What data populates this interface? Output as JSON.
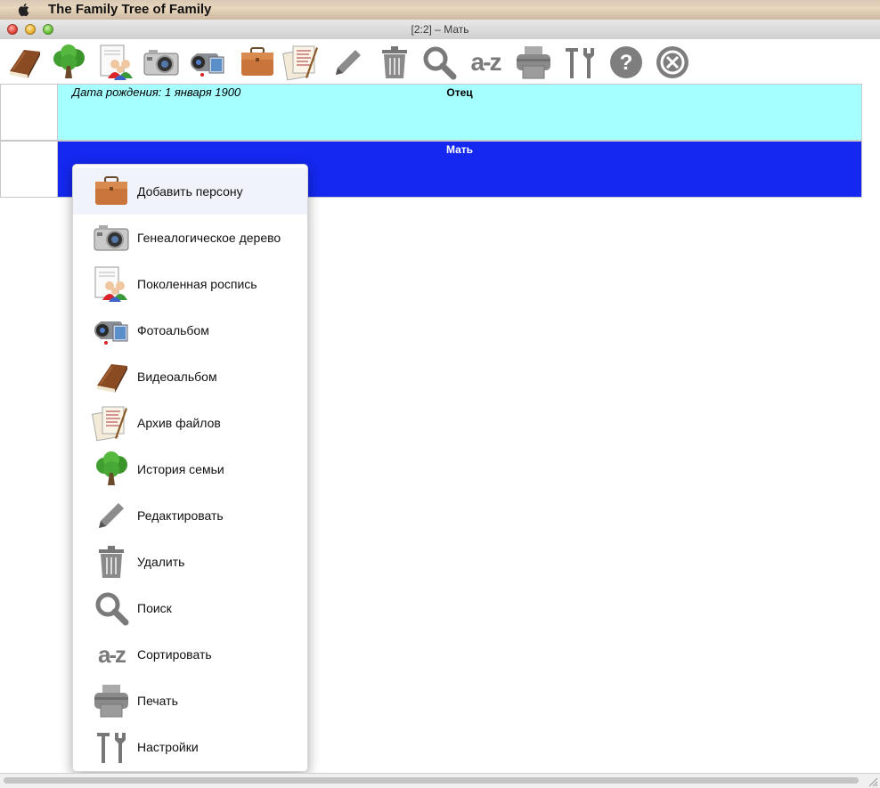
{
  "menubar": {
    "app_title": "The Family Tree of Family"
  },
  "window": {
    "title": "[2:2] – Мать"
  },
  "toolbar": {
    "items": [
      {
        "name": "video-album-icon"
      },
      {
        "name": "family-history-icon"
      },
      {
        "name": "generation-list-icon"
      },
      {
        "name": "genealogy-tree-icon"
      },
      {
        "name": "photo-album-icon"
      },
      {
        "name": "add-person-icon"
      },
      {
        "name": "file-archive-icon"
      },
      {
        "name": "edit-icon"
      },
      {
        "name": "delete-icon"
      },
      {
        "name": "search-icon"
      },
      {
        "name": "sort-icon"
      },
      {
        "name": "print-icon"
      },
      {
        "name": "settings-icon"
      },
      {
        "name": "help-icon"
      },
      {
        "name": "close-icon"
      }
    ]
  },
  "tree": {
    "father": {
      "title": "Отец",
      "birth": "Дата рождения: 1 января 1900",
      "color": "#a6ffff"
    },
    "mother": {
      "title": "Мать",
      "color": "#1428f0"
    }
  },
  "context_menu": {
    "items": [
      {
        "label": "Добавить персону",
        "icon": "briefcase-icon"
      },
      {
        "label": "Генеалогическое дерево",
        "icon": "camera-icon"
      },
      {
        "label": "Поколенная роспись",
        "icon": "people-document-icon"
      },
      {
        "label": "Фотоальбом",
        "icon": "camcorder-icon"
      },
      {
        "label": "Видеоальбом",
        "icon": "book-icon"
      },
      {
        "label": "Архив файлов",
        "icon": "papers-pen-icon"
      },
      {
        "label": "История семьи",
        "icon": "tree-icon"
      },
      {
        "label": "Редактировать",
        "icon": "pencil-icon"
      },
      {
        "label": "Удалить",
        "icon": "trash-icon"
      },
      {
        "label": "Поиск",
        "icon": "magnifier-icon"
      },
      {
        "label": "Сортировать",
        "icon": "a-z-icon"
      },
      {
        "label": "Печать",
        "icon": "printer-icon"
      },
      {
        "label": "Настройки",
        "icon": "tools-icon"
      }
    ]
  },
  "sort_glyph": "a-z"
}
